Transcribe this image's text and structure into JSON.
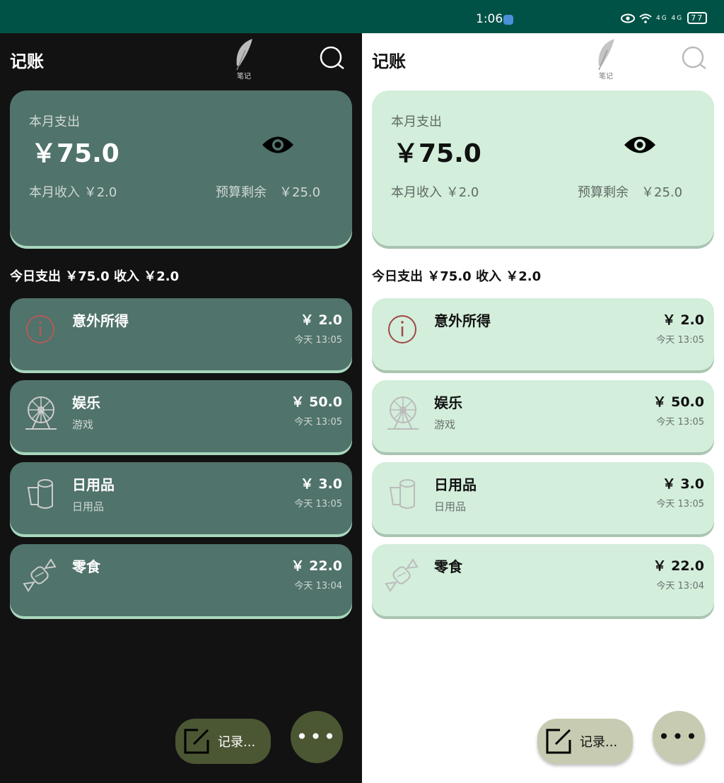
{
  "status": {
    "time": "1:06",
    "network": "4G 4G",
    "battery": "77"
  },
  "app": {
    "title": "记账",
    "logo_label": "笔记"
  },
  "summary": {
    "label": "本月支出",
    "amount": "￥75.0",
    "income": "本月收入 ￥2.0",
    "budget": "预算剩余　￥25.0"
  },
  "today": {
    "summary": "今日支出 ￥75.0 收入 ￥2.0"
  },
  "records": [
    {
      "category": "意外所得",
      "note": "",
      "amount": "￥ 2.0",
      "time": "今天 13:05",
      "icon": "info-circle-icon"
    },
    {
      "category": "娱乐",
      "note": "游戏",
      "amount": "￥ 50.0",
      "time": "今天 13:05",
      "icon": "ferris-wheel-icon"
    },
    {
      "category": "日用品",
      "note": "日用品",
      "amount": "￥ 3.0",
      "time": "今天 13:05",
      "icon": "toilet-paper-icon"
    },
    {
      "category": "零食",
      "note": "",
      "amount": "￥ 22.0",
      "time": "今天 13:04",
      "icon": "candy-icon"
    }
  ],
  "actions": {
    "record_label": "记录...",
    "more_label": "•••"
  },
  "colors": {
    "status_bar": "#005246",
    "dark_card": "#50736b",
    "light_card": "#d3eedb",
    "fab_dark": "#4b5633",
    "fab_light": "#c6cbb1"
  }
}
